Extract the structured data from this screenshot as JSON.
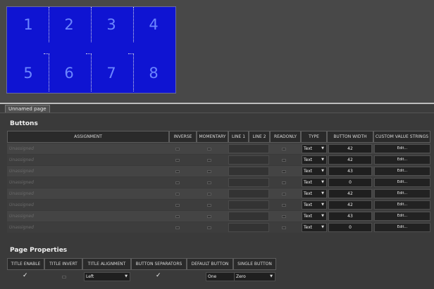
{
  "preview": {
    "buttons": [
      "1",
      "2",
      "3",
      "4",
      "5",
      "6",
      "7",
      "8"
    ],
    "colors": {
      "panel_bg": "#0f14d2",
      "number": "#6c86ff"
    }
  },
  "tab": {
    "label": "Unnamed page"
  },
  "buttons_section": {
    "title": "Buttons",
    "columns": [
      "ASSIGNMENT",
      "INVERSE",
      "MOMENTARY",
      "LINE 1",
      "LINE 2",
      "READONLY",
      "TYPE",
      "BUTTON WIDTH",
      "CUSTOM VALUE STRINGS"
    ],
    "rows": [
      {
        "assignment": "Unassigned",
        "type": "Text",
        "width": "42",
        "custom": "Edit..."
      },
      {
        "assignment": "Unassigned",
        "type": "Text",
        "width": "42",
        "custom": "Edit..."
      },
      {
        "assignment": "Unassigned",
        "type": "Text",
        "width": "43",
        "custom": "Edit..."
      },
      {
        "assignment": "Unassigned",
        "type": "Text",
        "width": "0",
        "custom": "Edit..."
      },
      {
        "assignment": "Unassigned",
        "type": "Text",
        "width": "42",
        "custom": "Edit..."
      },
      {
        "assignment": "Unassigned",
        "type": "Text",
        "width": "42",
        "custom": "Edit..."
      },
      {
        "assignment": "Unassigned",
        "type": "Text",
        "width": "43",
        "custom": "Edit..."
      },
      {
        "assignment": "Unassigned",
        "type": "Text",
        "width": "0",
        "custom": "Edit..."
      }
    ]
  },
  "page_properties": {
    "title": "Page Properties",
    "columns": [
      "TITLE ENABLE",
      "TITLE INVERT",
      "TITLE ALIGNMENT",
      "BUTTON SEPARATORS",
      "DEFAULT BUTTON",
      "SINGLE BUTTON"
    ],
    "values": {
      "title_enable": "✓",
      "title_alignment": "Left",
      "button_separators": "✓",
      "default_button": "One",
      "single_button": "Zero"
    }
  }
}
